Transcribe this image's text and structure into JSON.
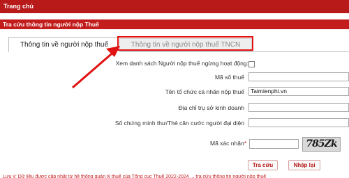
{
  "topbar": {
    "home_label": "Trang chủ"
  },
  "section": {
    "title": "Tra cứu thông tin người nộp Thuế"
  },
  "tabs": [
    {
      "label": "Thông tin về người nộp thuế",
      "active": true
    },
    {
      "label": "Thông tin về người nộp thuế TNCN",
      "active": false,
      "highlighted": true
    }
  ],
  "form": {
    "inactive_list_label": "Xem danh sách Người nộp thuế ngừng hoạt động:",
    "inactive_list_checked": false,
    "tax_code_label": "Mã số thuế",
    "tax_code_value": "",
    "name_label": "Tên tổ chức cá nhân nộp thuế",
    "name_value": "Taimienphi.vn",
    "address_label": "Địa chỉ trụ sở kinh doanh",
    "address_value": "",
    "id_label": "Số chứng minh thư/Thẻ căn cước người đại diện",
    "id_value": "",
    "captcha_label": "Mã xác nhận",
    "captcha_required_mark": "*",
    "captcha_value": "",
    "captcha_image_text": "785Zk"
  },
  "buttons": {
    "search": "Tra cứu",
    "reset": "Nhập lại"
  },
  "footer_note": "Lưu ý: Dữ liệu được cập nhật từ hệ thống quản lý thuế của Tổng cục Thuế 2022-2024 ... tra cứu thông tin người nộp thuế"
}
